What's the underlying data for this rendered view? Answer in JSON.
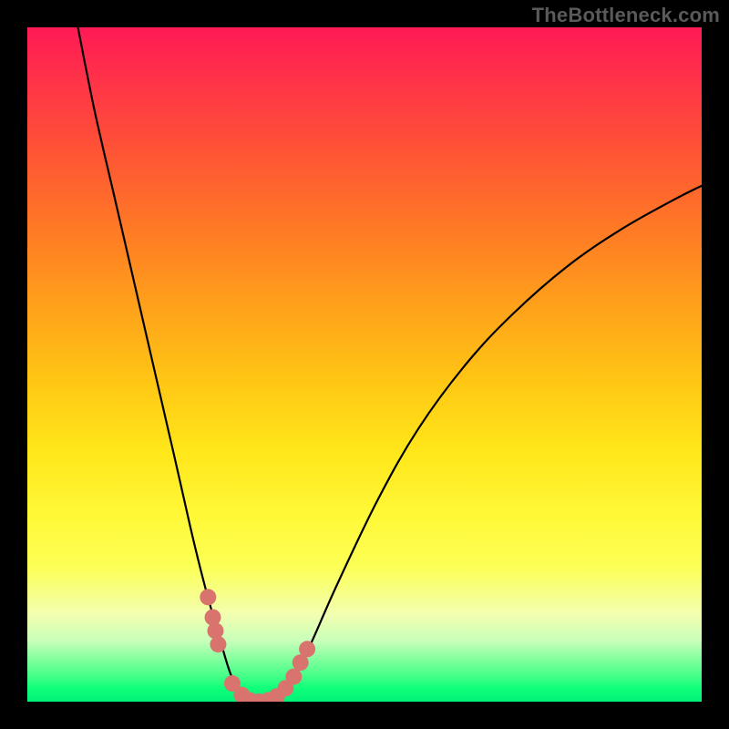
{
  "watermark": "TheBottleneck.com",
  "chart_data": {
    "type": "line",
    "title": "",
    "xlabel": "",
    "ylabel": "",
    "xlim": [
      0,
      1
    ],
    "ylim": [
      0,
      1
    ],
    "gradient_stops": [
      {
        "pos": 0.0,
        "color": "#ff1a55"
      },
      {
        "pos": 0.5,
        "color": "#ffd21a"
      },
      {
        "pos": 0.8,
        "color": "#fff74a"
      },
      {
        "pos": 0.95,
        "color": "#7bff9b"
      },
      {
        "pos": 1.0,
        "color": "#00f277"
      }
    ],
    "curve": {
      "x": [
        0.075,
        0.1,
        0.13,
        0.16,
        0.19,
        0.22,
        0.245,
        0.265,
        0.285,
        0.3,
        0.315,
        0.33,
        0.35,
        0.37,
        0.395,
        0.42,
        0.46,
        0.52,
        0.58,
        0.65,
        0.72,
        0.8,
        0.88,
        0.96,
        1.0
      ],
      "y": [
        1.0,
        0.875,
        0.745,
        0.615,
        0.485,
        0.355,
        0.245,
        0.165,
        0.095,
        0.045,
        0.012,
        0.0,
        0.0,
        0.007,
        0.035,
        0.085,
        0.175,
        0.3,
        0.405,
        0.5,
        0.575,
        0.645,
        0.7,
        0.745,
        0.765
      ]
    },
    "markers": {
      "color": "#d9736e",
      "radius_px": 9,
      "points": [
        {
          "x": 0.268,
          "y": 0.155
        },
        {
          "x": 0.275,
          "y": 0.125
        },
        {
          "x": 0.279,
          "y": 0.105
        },
        {
          "x": 0.283,
          "y": 0.085
        },
        {
          "x": 0.304,
          "y": 0.027
        },
        {
          "x": 0.318,
          "y": 0.01
        },
        {
          "x": 0.33,
          "y": 0.002
        },
        {
          "x": 0.343,
          "y": 0.0
        },
        {
          "x": 0.357,
          "y": 0.002
        },
        {
          "x": 0.37,
          "y": 0.008
        },
        {
          "x": 0.383,
          "y": 0.02
        },
        {
          "x": 0.395,
          "y": 0.037
        },
        {
          "x": 0.405,
          "y": 0.058
        },
        {
          "x": 0.415,
          "y": 0.078
        }
      ]
    }
  }
}
